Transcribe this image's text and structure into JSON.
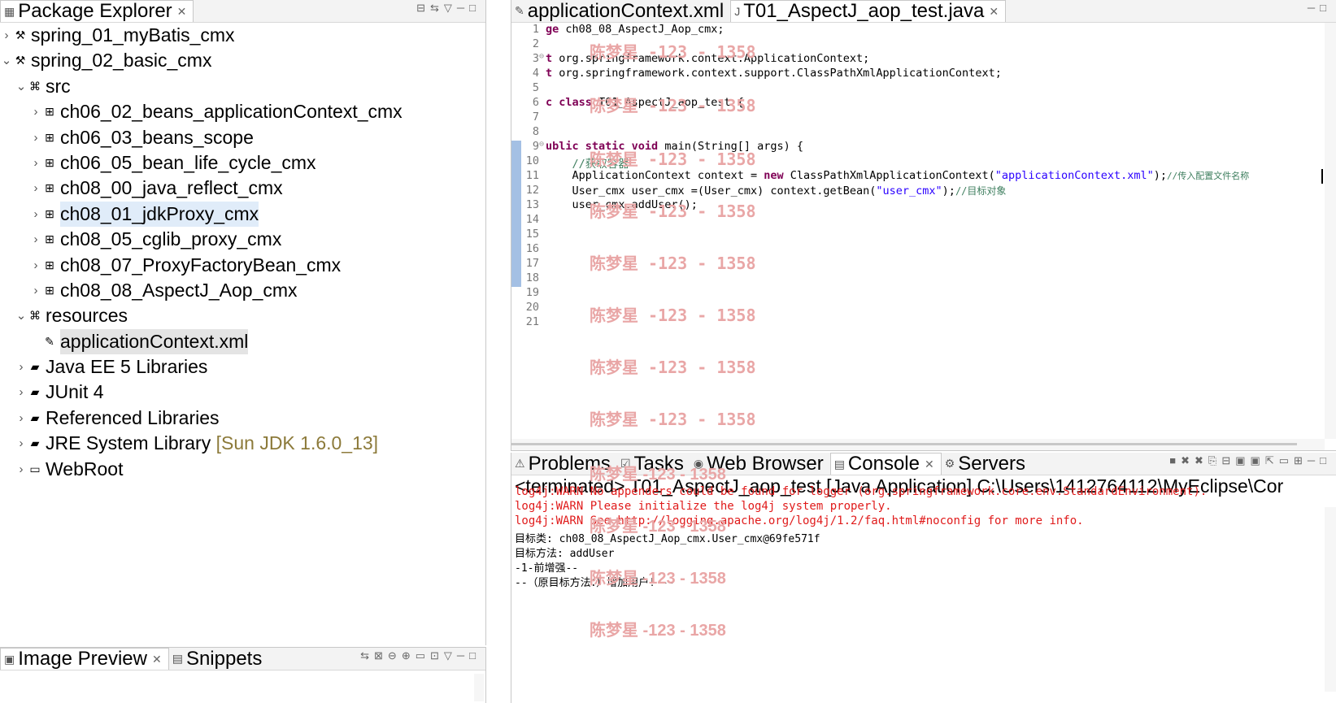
{
  "package_explorer": {
    "tab_label": "Package Explorer",
    "items": [
      {
        "label": "spring_01_myBatis_cmx",
        "toggle": "›",
        "icon": "⚒"
      },
      {
        "label": "spring_02_basic_cmx",
        "toggle": "⌄",
        "icon": "⚒"
      },
      {
        "label": "src",
        "toggle": "⌄",
        "icon": "⌘"
      },
      {
        "label": "ch06_02_beans_applicationContext_cmx",
        "toggle": "›",
        "icon": "⊞"
      },
      {
        "label": "ch06_03_beans_scope",
        "toggle": "›",
        "icon": "⊞"
      },
      {
        "label": "ch06_05_bean_life_cycle_cmx",
        "toggle": "›",
        "icon": "⊞"
      },
      {
        "label": "ch08_00_java_reflect_cmx",
        "toggle": "›",
        "icon": "⊞"
      },
      {
        "label": "ch08_01_jdkProxy_cmx",
        "toggle": "›",
        "icon": "⊞"
      },
      {
        "label": "ch08_05_cglib_proxy_cmx",
        "toggle": "›",
        "icon": "⊞"
      },
      {
        "label": "ch08_07_ProxyFactoryBean_cmx",
        "toggle": "›",
        "icon": "⊞"
      },
      {
        "label": "ch08_08_AspectJ_Aop_cmx",
        "toggle": "›",
        "icon": "⊞"
      },
      {
        "label": "resources",
        "toggle": "⌄",
        "icon": "⌘"
      },
      {
        "label": "applicationContext.xml",
        "toggle": "",
        "icon": "✎"
      },
      {
        "label": "Java EE 5 Libraries",
        "toggle": "›",
        "icon": "▰"
      },
      {
        "label": "JUnit 4",
        "toggle": "›",
        "icon": "▰"
      },
      {
        "label": "Referenced Libraries",
        "toggle": "›",
        "icon": "▰"
      },
      {
        "label": "JRE System Library",
        "suffix": "[Sun JDK 1.6.0_13]",
        "toggle": "›",
        "icon": "▰"
      },
      {
        "label": "WebRoot",
        "toggle": "›",
        "icon": "▭"
      }
    ]
  },
  "bottom_left": {
    "tab1": "Image Preview",
    "tab2": "Snippets"
  },
  "editor": {
    "tab1": "applicationContext.xml",
    "tab2": "T01_AspectJ_aop_test.java",
    "line_numbers": [
      "1",
      "2",
      "3",
      "4",
      "5",
      "6",
      "7",
      "8",
      "9",
      "10",
      "11",
      "12",
      "13",
      "14",
      "15",
      "16",
      "17",
      "18",
      "19",
      "20",
      "21"
    ],
    "code": {
      "l1_kw": "ge",
      "l1_rest": " ch08_08_AspectJ_Aop_cmx;",
      "l3_kw": "t",
      "l3_rest": " org.springframework.context.ApplicationContext;",
      "l4_kw": "t",
      "l4_rest": " org.springframework.context.support.ClassPathXmlApplicationContext;",
      "l6_kw": "c class",
      "l6_rest": " T01_AspectJ_aop_test {",
      "l9_a": "ublic ",
      "l9_kw": "static void",
      "l9_rest": " main(String[] args) {",
      "l10_com": "    //获取容器",
      "l11_a": "    ApplicationContext context = ",
      "l11_kw": "new",
      "l11_b": " ClassPathXmlApplicationContext(",
      "l11_str": "\"applicationContext.xml\"",
      "l11_c": ");",
      "l11_com": "//传入配置文件名称",
      "l12_a": "    User_cmx user_cmx =(User_cmx) context.getBean(",
      "l12_str": "\"user_cmx\"",
      "l12_c": ");",
      "l12_com": "//目标对象",
      "l13": "    user_cmx.addUser();"
    }
  },
  "watermark": "陈梦星 -123 - 1358",
  "console": {
    "tabs": [
      "Problems",
      "Tasks",
      "Web Browser",
      "Console",
      "Servers"
    ],
    "header": "<terminated> T01_AspectJ_aop_test [Java Application] C:\\Users\\1412764112\\MyEclipse\\Cor",
    "lines": [
      {
        "text": "log4j:WARN No appenders could be found for logger (org.springframework.core.env.StandardEnvironment).",
        "kind": "warn"
      },
      {
        "text": "log4j:WARN Please initialize the log4j system properly.",
        "kind": "warn"
      },
      {
        "text": "log4j:WARN See http://logging.apache.org/log4j/1.2/faq.html#noconfig for more info.",
        "kind": "warn"
      },
      {
        "text": "目标类: ch08_08_AspectJ_Aop_cmx.User_cmx@69fe571f",
        "kind": "norm"
      },
      {
        "text": "目标方法: addUser",
        "kind": "norm"
      },
      {
        "text": "-1-前增强--",
        "kind": "norm"
      },
      {
        "text": "--（原目标方法：）增加用户! --",
        "kind": "norm"
      }
    ]
  }
}
